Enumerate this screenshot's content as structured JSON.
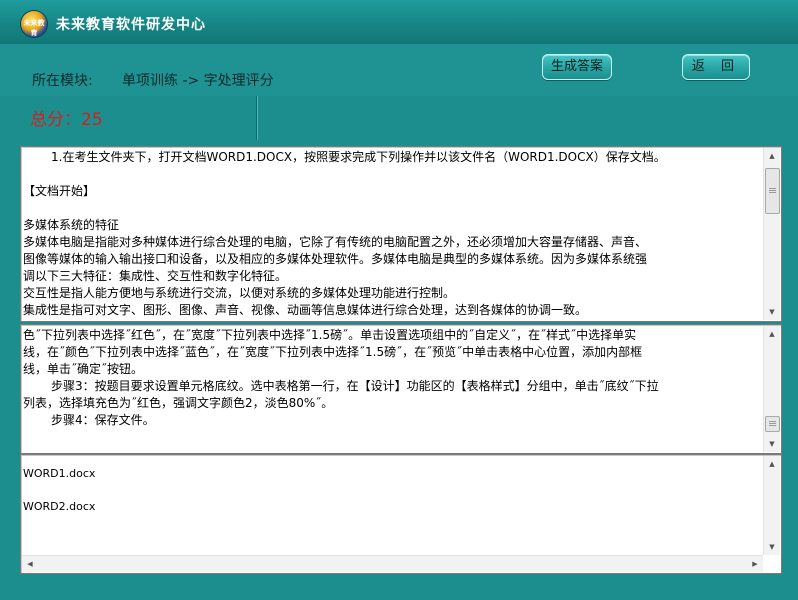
{
  "window": {
    "title": "未来教育软件研发中心",
    "logo_text": "未来教育"
  },
  "header": {
    "module_label": "所在模块:",
    "module_value": "单项训练 -> 字处理评分",
    "generate_button": "生成答案",
    "back_button": "返 回"
  },
  "score": {
    "text": "总分：25"
  },
  "question_panel": {
    "line1": "1.在考生文件夹下，打开文档WORD1.DOCX，按照要求完成下列操作并以该文件名（WORD1.DOCX）保存文档。",
    "line2": "【文档开始】",
    "line3": "多媒体系统的特征",
    "line4": "多媒体电脑是指能对多种媒体进行综合处理的电脑，它除了有传统的电脑配置之外，还必须增加大容量存储器、声音、",
    "line5": "图像等媒体的输入输出接口和设备，以及相应的多媒体处理软件。多媒体电脑是典型的多媒体系统。因为多媒体系统强",
    "line6": "调以下三大特征：集成性、交互性和数字化特征。",
    "line7": "交互性是指人能方便地与系统进行交流，以便对系统的多媒体处理功能进行控制。",
    "line8": "集成性是指可对文字、图形、图像、声音、视像、动画等信息媒体进行综合处理，达到各媒体的协调一致。"
  },
  "steps_panel": {
    "line1": "色˝下拉列表中选择˝红色˝，在˝宽度˝下拉列表中选择˝1.5磅˝。单击设置选项组中的˝自定义˝，在˝样式˝中选择单实",
    "line2": "线，在˝颜色˝下拉列表中选择˝蓝色˝，在˝宽度˝下拉列表中选择˝1.5磅˝，在˝预览˝中单击表格中心位置，添加内部框",
    "line3": "线，单击˝确定˝按钮。",
    "line4": "步骤3：按题目要求设置单元格底纹。选中表格第一行，在【设计】功能区的【表格样式】分组中，单击˝底纹˝下拉",
    "line5": "列表，选择填充色为˝红色，强调文字颜色2，淡色80%˝。",
    "line6": "步骤4：保存文件。"
  },
  "files_panel": {
    "files": [
      "WORD1.docx",
      "WORD2.docx"
    ]
  },
  "colors": {
    "background": "#1d8e8e",
    "score_red": "#d41f1f"
  },
  "icons": {
    "scroll_up": "scroll-up-arrow-icon",
    "scroll_down": "scroll-down-arrow-icon",
    "scroll_left": "scroll-left-arrow-icon",
    "scroll_right": "scroll-right-arrow-icon"
  }
}
